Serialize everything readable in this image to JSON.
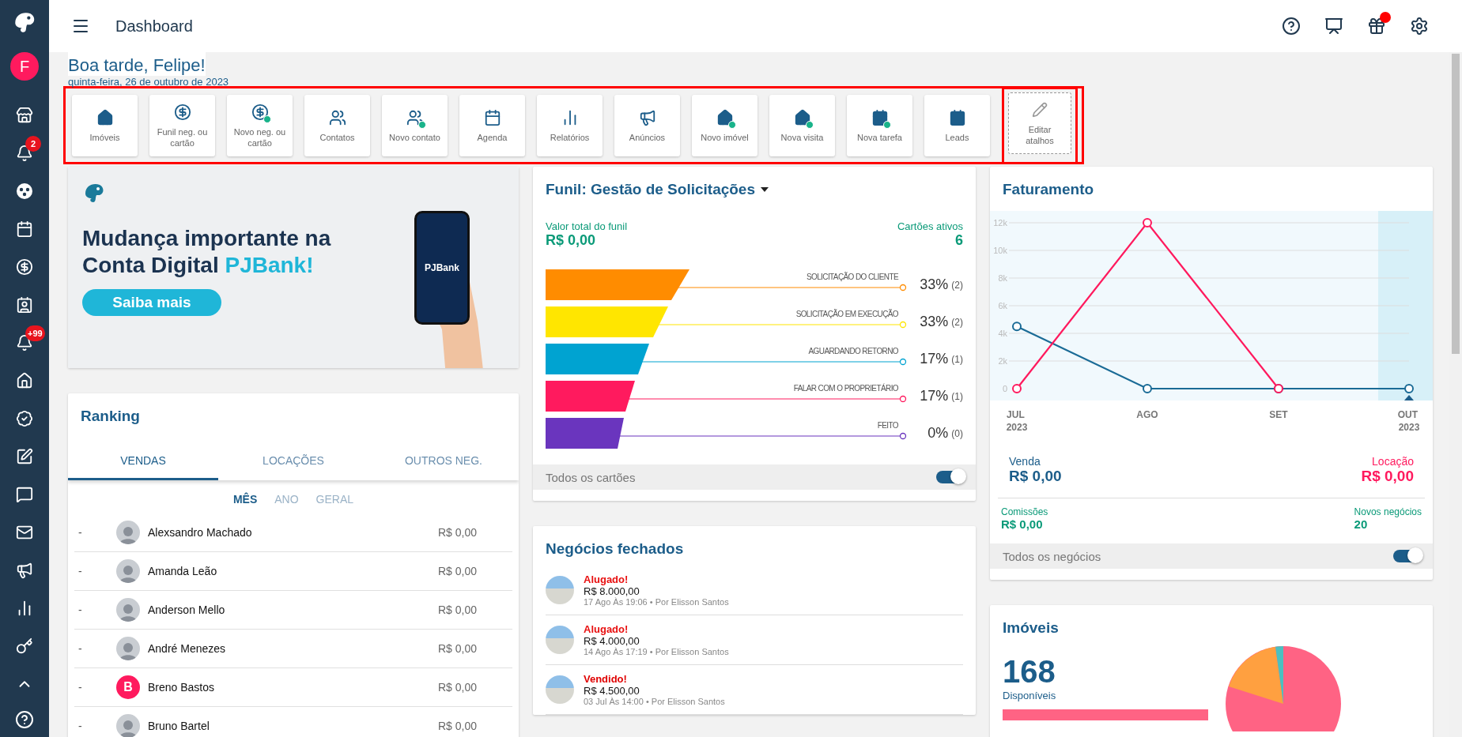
{
  "sidebar": {
    "avatar_initial": "F",
    "badges": [
      {
        "text": "2"
      },
      {
        "text": "+99"
      }
    ]
  },
  "header": {
    "title": "Dashboard",
    "gift_notification": true
  },
  "greeting": {
    "title": "Boa tarde, Felipe!",
    "date": "quinta-feira, 26 de outubro de 2023"
  },
  "shortcuts": {
    "highlighted": true,
    "items": [
      {
        "kind": "shortcut",
        "label": "Imóveis"
      },
      {
        "kind": "shortcut",
        "label": "Funil neg. ou cartão"
      },
      {
        "kind": "shortcut",
        "label": "Novo neg. ou cartão"
      },
      {
        "kind": "shortcut",
        "label": "Contatos"
      },
      {
        "kind": "shortcut",
        "label": "Novo contato"
      },
      {
        "kind": "shortcut",
        "label": "Agenda"
      },
      {
        "kind": "shortcut",
        "label": "Relatórios"
      },
      {
        "kind": "shortcut",
        "label": "Anúncios"
      },
      {
        "kind": "shortcut",
        "label": "Novo imóvel"
      },
      {
        "kind": "shortcut",
        "label": "Nova visita"
      },
      {
        "kind": "shortcut",
        "label": "Nova tarefa"
      },
      {
        "kind": "shortcut",
        "label": "Leads"
      },
      {
        "kind": "edit",
        "label": "Editar atalhos",
        "highlighted": true
      }
    ]
  },
  "banner": {
    "headline": "Mudança importante na Conta Digital",
    "brand": "PJBank!",
    "button": "Saiba mais",
    "phone_text": "PJBank"
  },
  "ranking": {
    "title": "Ranking",
    "tabs": [
      {
        "label": "VENDAS",
        "selected": true
      },
      {
        "label": "LOCAÇÕES",
        "selected": false
      },
      {
        "label": "OUTROS NEG.",
        "selected": false
      }
    ],
    "periods": [
      {
        "label": "MÊS",
        "selected": true
      },
      {
        "label": "ANO",
        "selected": false
      },
      {
        "label": "GERAL",
        "selected": false
      }
    ],
    "rows": [
      {
        "position": "-",
        "name": "Alexsandro Machado",
        "value": "R$ 0,00",
        "kind": "photo"
      },
      {
        "position": "-",
        "name": "Amanda Leão",
        "value": "R$ 0,00",
        "kind": "photo"
      },
      {
        "position": "-",
        "name": "Anderson Mello",
        "value": "R$ 0,00",
        "kind": "photo"
      },
      {
        "position": "-",
        "name": "André Menezes",
        "value": "R$ 0,00",
        "kind": "photo"
      },
      {
        "position": "-",
        "name": "Breno Bastos",
        "value": "R$ 0,00",
        "kind": "initial",
        "initial": "B"
      },
      {
        "position": "-",
        "name": "Bruno Bartel",
        "value": "R$ 0,00",
        "kind": "photo"
      }
    ]
  },
  "funnel": {
    "title": "Funil: Gestão de Solicitações",
    "total_label": "Valor total do funil",
    "total": "R$ 0,00",
    "active_label": "Cartões ativos",
    "active": "6",
    "stages": [
      {
        "label": "SOLICITAÇÃO DO CLIENTE",
        "percent": "33%",
        "count": "(2)",
        "color": "#ff8c00"
      },
      {
        "label": "SOLICITAÇÃO EM EXECUÇÃO",
        "percent": "33%",
        "count": "(2)",
        "color": "#ffe600"
      },
      {
        "label": "AGUARDANDO RETORNO",
        "percent": "17%",
        "count": "(1)",
        "color": "#00a3d1"
      },
      {
        "label": "FALAR COM O PROPRIETÁRIO",
        "percent": "17%",
        "count": "(1)",
        "color": "#ff1a5e"
      },
      {
        "label": "FEITO",
        "percent": "0%",
        "count": "(0)",
        "color": "#6a35be"
      }
    ],
    "footer": {
      "label": "Todos os cartões",
      "on": true
    }
  },
  "closed_deals": {
    "title": "Negócios fechados",
    "items": [
      {
        "kind": "rent",
        "status": "Alugado!",
        "amount": "R$ 8.000,00",
        "meta": "17 Ago Às 19:06 • Por Elisson Santos"
      },
      {
        "kind": "rent",
        "status": "Alugado!",
        "amount": "R$ 4.000,00",
        "meta": "14 Ago Às 17:19 • Por Elisson Santos"
      },
      {
        "kind": "sale",
        "status": "Vendido!",
        "amount": "R$ 4.500,00",
        "meta": "03 Jul Às 14:00 • Por Elisson Santos"
      }
    ]
  },
  "billing": {
    "title": "Faturamento",
    "chart_data": {
      "type": "line",
      "categories": [
        "JUL 2023",
        "AGO",
        "SET",
        "OUT 2023"
      ],
      "series": [
        {
          "name": "Venda",
          "color": "#1a6b96",
          "marker": "o",
          "values": [
            4500,
            0,
            0,
            0
          ]
        },
        {
          "name": "Locação",
          "color": "#ff1a5e",
          "marker": "o",
          "values": [
            0,
            12000,
            0,
            null
          ]
        }
      ],
      "ylim": [
        0,
        12000
      ],
      "grid": true,
      "yticks": [
        {
          "value": 0,
          "label": "0"
        },
        {
          "value": 2000,
          "label": "2k"
        },
        {
          "value": 4000,
          "label": "4k"
        },
        {
          "value": 6000,
          "label": "6k"
        },
        {
          "value": 8000,
          "label": "8k"
        },
        {
          "value": 10000,
          "label": "10k"
        },
        {
          "value": 12000,
          "label": "12k"
        }
      ]
    },
    "sale_value": "R$ 0,00",
    "rent_value": "R$ 0,00",
    "commission_label": "Comissões",
    "commission_value": "R$ 0,00",
    "new_label": "Novos negócios",
    "new_value": "20",
    "footer": {
      "label": "Todos os negócios",
      "on": true
    }
  },
  "properties": {
    "title": "Imóveis",
    "count": "168",
    "count_label": "Disponíveis"
  }
}
